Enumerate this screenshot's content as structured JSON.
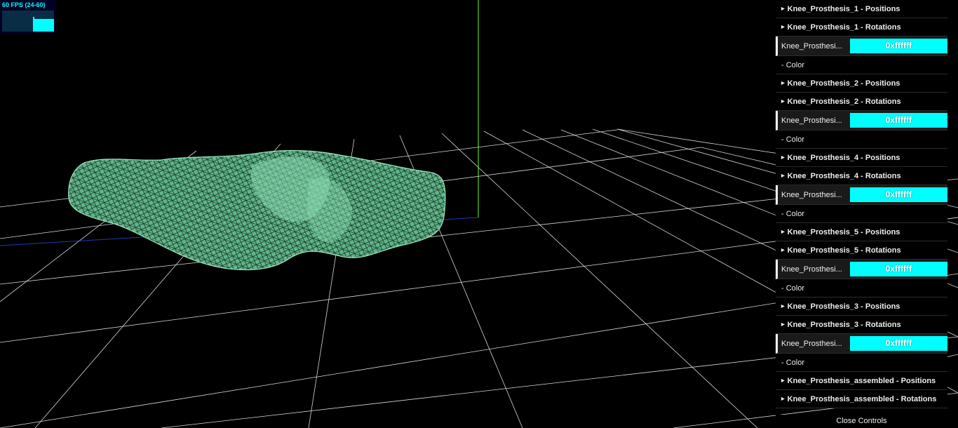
{
  "stats": {
    "fps_label": "60 FPS (24-60)"
  },
  "gui": {
    "rows": [
      {
        "type": "folder",
        "label": "Knee_Prosthesis_1 - Positions"
      },
      {
        "type": "folder",
        "label": "Knee_Prosthesis_1 - Rotations"
      },
      {
        "type": "color",
        "name": "Knee_Prosthesi...",
        "value": "0xffffff"
      },
      {
        "type": "plain",
        "label": "- Color"
      },
      {
        "type": "folder",
        "label": "Knee_Prosthesis_2 - Positions"
      },
      {
        "type": "folder",
        "label": "Knee_Prosthesis_2 - Rotations"
      },
      {
        "type": "color",
        "name": "Knee_Prosthesi...",
        "value": "0xffffff"
      },
      {
        "type": "plain",
        "label": "- Color"
      },
      {
        "type": "folder",
        "label": "Knee_Prosthesis_4 - Positions"
      },
      {
        "type": "folder",
        "label": "Knee_Prosthesis_4 - Rotations"
      },
      {
        "type": "color",
        "name": "Knee_Prosthesi...",
        "value": "0xffffff"
      },
      {
        "type": "plain",
        "label": "- Color"
      },
      {
        "type": "folder",
        "label": "Knee_Prosthesis_5 - Positions"
      },
      {
        "type": "folder",
        "label": "Knee_Prosthesis_5 - Rotations"
      },
      {
        "type": "color",
        "name": "Knee_Prosthesi...",
        "value": "0xffffff"
      },
      {
        "type": "plain",
        "label": "- Color"
      },
      {
        "type": "folder",
        "label": "Knee_Prosthesis_3 - Positions"
      },
      {
        "type": "folder",
        "label": "Knee_Prosthesis_3 - Rotations"
      },
      {
        "type": "color",
        "name": "Knee_Prosthesi...",
        "value": "0xffffff"
      },
      {
        "type": "plain",
        "label": "- Color"
      },
      {
        "type": "folder",
        "label": "Knee_Prosthesis_assembled - Positions"
      },
      {
        "type": "folder",
        "label": "Knee_Prosthesis_assembled - Rotations"
      }
    ],
    "close_label": "Close Controls",
    "swatch_color": "#00ffff"
  },
  "scene": {
    "background": "#000000",
    "grid_color": "#ffffff",
    "axis_color": "#66ff33",
    "model_color": "#7fd6a4"
  }
}
